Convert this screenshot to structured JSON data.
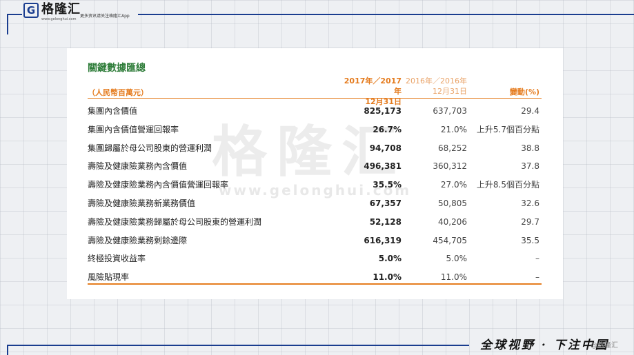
{
  "header": {
    "logo_letter": "G",
    "brand": "格隆汇",
    "brand_url": "www.gelonghui.com",
    "tagline": "更多资讯请关注格隆汇App"
  },
  "footer": {
    "slogan": "全球视野 · 下注中国",
    "credit": "@格隆汇"
  },
  "watermark": {
    "text": "格隆汇",
    "url": "www.gelonghui.com"
  },
  "table": {
    "title": "關鍵數據匯總",
    "unit": "（人民幣百萬元）",
    "col1": [
      "2017年／2017年",
      "12月31日"
    ],
    "col2": [
      "2016年／2016年",
      "12月31日"
    ],
    "col3": "變動(%)",
    "rows": [
      {
        "label": "集團內含價值",
        "v2017": "825,173",
        "v2016": "637,703",
        "change": "29.4"
      },
      {
        "label": "集團內含價值營運回報率",
        "v2017": "26.7%",
        "v2016": "21.0%",
        "change": "上升5.7個百分點"
      },
      {
        "label": "集團歸屬於母公司股東的營運利潤",
        "v2017": "94,708",
        "v2016": "68,252",
        "change": "38.8"
      },
      {
        "label": "壽險及健康險業務內含價值",
        "v2017": "496,381",
        "v2016": "360,312",
        "change": "37.8"
      },
      {
        "label": "壽險及健康險業務內含價值營運回報率",
        "v2017": "35.5%",
        "v2016": "27.0%",
        "change": "上升8.5個百分點"
      },
      {
        "label": "壽險及健康險業務新業務價值",
        "v2017": "67,357",
        "v2016": "50,805",
        "change": "32.6"
      },
      {
        "label": "壽險及健康險業務歸屬於母公司股東的營運利潤",
        "v2017": "52,128",
        "v2016": "40,206",
        "change": "29.7"
      },
      {
        "label": "壽險及健康險業務剩餘邊際",
        "v2017": "616,319",
        "v2016": "454,705",
        "change": "35.5"
      },
      {
        "label": "終極投資收益率",
        "v2017": "5.0%",
        "v2016": "5.0%",
        "change": "–"
      },
      {
        "label": "風險貼現率",
        "v2017": "11.0%",
        "v2016": "11.0%",
        "change": "–"
      }
    ]
  },
  "colors": {
    "accent": "#e57c1f",
    "title": "#2f7d3a",
    "frame": "#1a3d8f"
  }
}
